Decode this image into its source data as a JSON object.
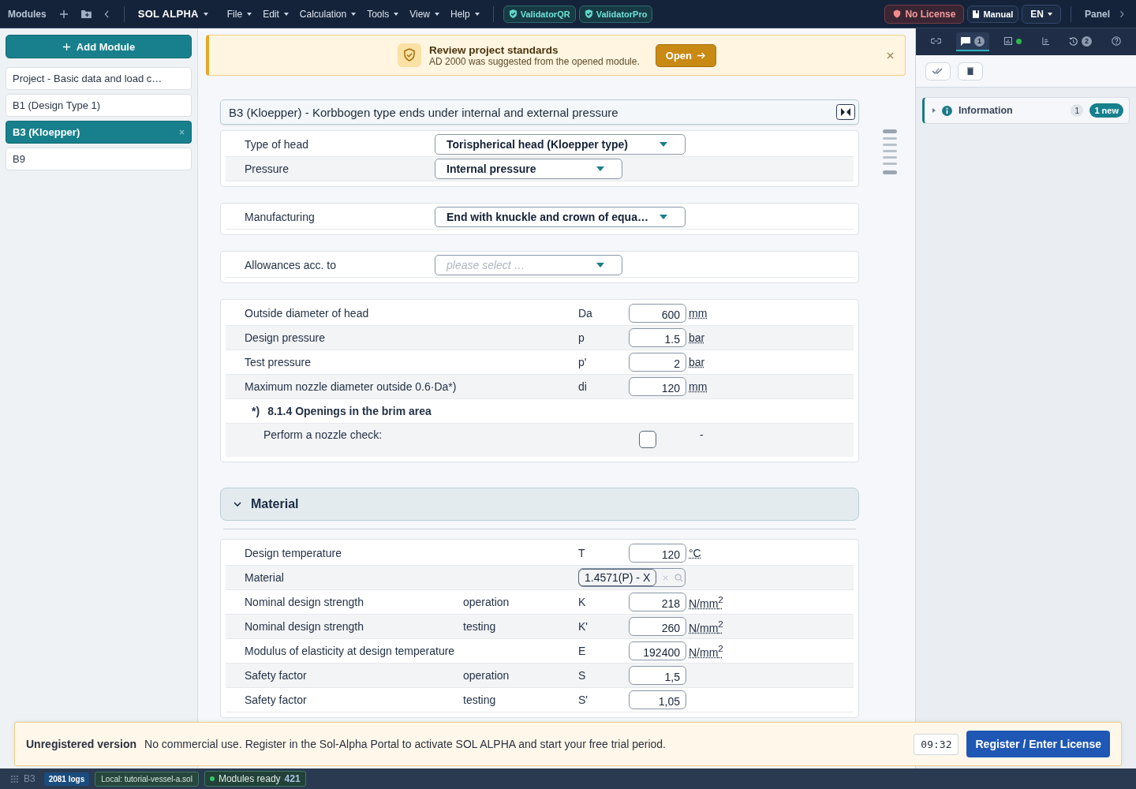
{
  "topbar": {
    "modules_label": "Modules",
    "app_name": "SOL ALPHA",
    "menus": [
      "File",
      "Edit",
      "Calculation",
      "Tools",
      "View",
      "Help"
    ],
    "validators": [
      "ValidatorQR",
      "ValidatorPro"
    ],
    "license": "No License",
    "manual": "Manual",
    "language": "EN",
    "panel": "Panel"
  },
  "sidebar": {
    "add_button": "Add Module",
    "items": [
      {
        "label": "Project - Basic data and load c…",
        "selected": false
      },
      {
        "label": "B1 (Design Type 1)",
        "selected": false
      },
      {
        "label": "B3 (Kloepper)",
        "selected": true
      },
      {
        "label": "B9",
        "selected": false
      }
    ]
  },
  "notice": {
    "title": "Review project standards",
    "text": "AD 2000 was suggested from the opened module.",
    "button": "Open"
  },
  "module": {
    "title": "B3 (Kloepper) - Korbbogen type ends under internal and external pressure",
    "sections": [
      {
        "rows": [
          {
            "kind": "select",
            "label": "Type of head",
            "value": "Torispherical head (Kloepper type)",
            "wide": true
          },
          {
            "kind": "select",
            "label": "Pressure",
            "value": "Internal pressure",
            "wide": false
          }
        ]
      },
      {
        "rows": [
          {
            "kind": "select",
            "label": "Manufacturing",
            "value": "End with knuckle and crown of equa…",
            "wide": true
          }
        ]
      },
      {
        "rows": [
          {
            "kind": "select",
            "label": "Allowances acc. to",
            "placeholder": "please select …",
            "wide": false
          }
        ]
      },
      {
        "rows": [
          {
            "kind": "input",
            "label": "Outside diameter of head",
            "symbol": "Da",
            "value": "600",
            "unit": "mm"
          },
          {
            "kind": "input",
            "label": "Design pressure",
            "symbol": "p",
            "value": "1.5",
            "unit": "bar"
          },
          {
            "kind": "input",
            "label": "Test pressure",
            "symbol": "p'",
            "value": "2",
            "unit": "bar"
          },
          {
            "kind": "input",
            "label": "Maximum nozzle diameter outside 0.6·Da*)",
            "symbol": "di",
            "value": "120",
            "unit": "mm"
          },
          {
            "kind": "note",
            "mark": "*)",
            "label": "8.1.4 Openings in the brim area"
          },
          {
            "kind": "checkbox",
            "label": "Perform a nozzle check:",
            "checked": false,
            "result": "-"
          }
        ]
      }
    ]
  },
  "material": {
    "title": "Material",
    "expanded": true,
    "rows": [
      {
        "kind": "input",
        "label": "Design temperature",
        "symbol": "T",
        "value": "120",
        "unit": "°C"
      },
      {
        "kind": "material",
        "label": "Material",
        "value": "1.4571(P) - X"
      },
      {
        "kind": "input",
        "label": "Nominal design strength",
        "qualifier": "operation",
        "symbol": "K",
        "value": "218",
        "unit": "N/mm$^{2}$"
      },
      {
        "kind": "input",
        "label": "Nominal design strength",
        "qualifier": "testing",
        "symbol": "K'",
        "value": "260",
        "unit": "N/mm$^{2}$"
      },
      {
        "kind": "input",
        "label": "Modulus of elasticity at design temperature",
        "symbol": "E",
        "value": "192400",
        "unit": "N/mm$^{2}$"
      },
      {
        "kind": "input",
        "label": "Safety factor",
        "qualifier": "operation",
        "symbol": "S",
        "value": "1,5"
      },
      {
        "kind": "input",
        "label": "Safety factor",
        "qualifier": "testing",
        "symbol": "S'",
        "value": "1,05"
      }
    ]
  },
  "panel": {
    "tabs": [
      {
        "kind": "link",
        "selected": false
      },
      {
        "kind": "messages",
        "badge": "1",
        "selected": true
      },
      {
        "kind": "results",
        "selected": false
      },
      {
        "kind": "list",
        "selected": false
      },
      {
        "kind": "history",
        "badge": "2",
        "selected": false
      },
      {
        "kind": "help",
        "selected": false
      }
    ],
    "items": [
      {
        "title": "Information",
        "count": "1",
        "new_badge": "1 new",
        "expanded": false
      }
    ]
  },
  "banner": {
    "title": "Unregistered version",
    "text": "No commercial use. Register in the Sol-Alpha Portal to activate SOL ALPHA and start your free trial period.",
    "timer": "09:32",
    "button": "Register / Enter License"
  },
  "status_bar": {
    "module": "B3",
    "logs": "2081 logs",
    "file": "Local: tutorial-vessel-a.sol",
    "ready": "Modules ready",
    "count": "421"
  }
}
